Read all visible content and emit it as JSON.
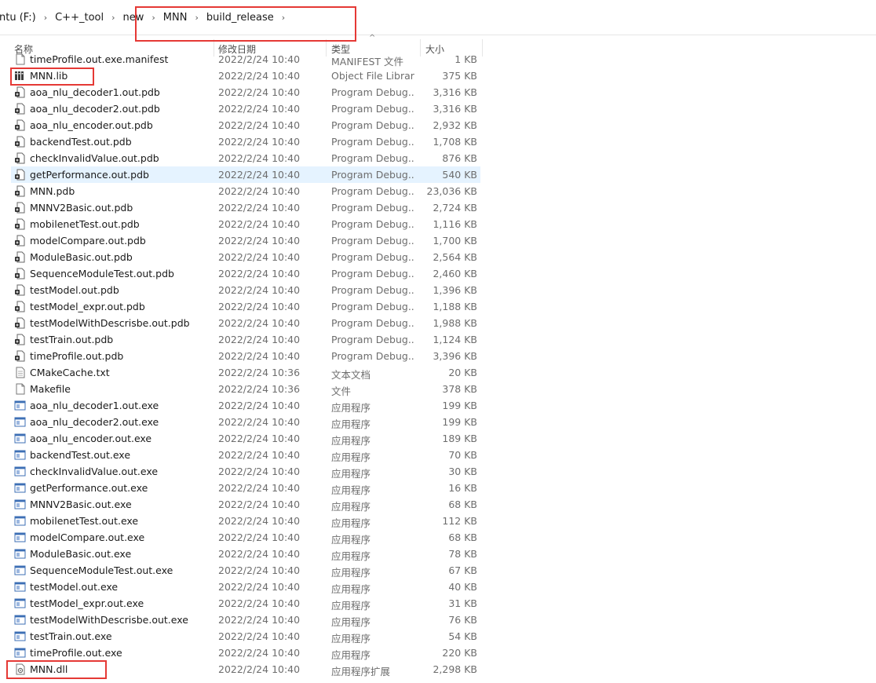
{
  "breadcrumb": {
    "items": [
      "ntu (F:)",
      "C++_tool",
      "new",
      "MNN",
      "build_release"
    ],
    "separator": "›"
  },
  "columns": {
    "name": "名称",
    "date": "修改日期",
    "type": "类型",
    "size": "大小",
    "sort_icon": "^"
  },
  "colors": {
    "highlight": "#e53935",
    "selected_row": "#e5f3ff"
  },
  "files": [
    {
      "name": "timeProfile.out.exe.manifest",
      "date": "2022/2/24 10:40",
      "type": "MANIFEST 文件",
      "size": "1 KB",
      "icon": "manifest-file-icon"
    },
    {
      "name": "MNN.lib",
      "date": "2022/2/24 10:40",
      "type": "Object File Library",
      "size": "375 KB",
      "icon": "library-file-icon"
    },
    {
      "name": "aoa_nlu_decoder1.out.pdb",
      "date": "2022/2/24 10:40",
      "type": "Program Debug...",
      "size": "3,316 KB",
      "icon": "pdb-file-icon"
    },
    {
      "name": "aoa_nlu_decoder2.out.pdb",
      "date": "2022/2/24 10:40",
      "type": "Program Debug...",
      "size": "3,316 KB",
      "icon": "pdb-file-icon"
    },
    {
      "name": "aoa_nlu_encoder.out.pdb",
      "date": "2022/2/24 10:40",
      "type": "Program Debug...",
      "size": "2,932 KB",
      "icon": "pdb-file-icon"
    },
    {
      "name": "backendTest.out.pdb",
      "date": "2022/2/24 10:40",
      "type": "Program Debug...",
      "size": "1,708 KB",
      "icon": "pdb-file-icon"
    },
    {
      "name": "checkInvalidValue.out.pdb",
      "date": "2022/2/24 10:40",
      "type": "Program Debug...",
      "size": "876 KB",
      "icon": "pdb-file-icon"
    },
    {
      "name": "getPerformance.out.pdb",
      "date": "2022/2/24 10:40",
      "type": "Program Debug...",
      "size": "540 KB",
      "icon": "pdb-file-icon"
    },
    {
      "name": "MNN.pdb",
      "date": "2022/2/24 10:40",
      "type": "Program Debug...",
      "size": "23,036 KB",
      "icon": "pdb-file-icon"
    },
    {
      "name": "MNNV2Basic.out.pdb",
      "date": "2022/2/24 10:40",
      "type": "Program Debug...",
      "size": "2,724 KB",
      "icon": "pdb-file-icon"
    },
    {
      "name": "mobilenetTest.out.pdb",
      "date": "2022/2/24 10:40",
      "type": "Program Debug...",
      "size": "1,116 KB",
      "icon": "pdb-file-icon"
    },
    {
      "name": "modelCompare.out.pdb",
      "date": "2022/2/24 10:40",
      "type": "Program Debug...",
      "size": "1,700 KB",
      "icon": "pdb-file-icon"
    },
    {
      "name": "ModuleBasic.out.pdb",
      "date": "2022/2/24 10:40",
      "type": "Program Debug...",
      "size": "2,564 KB",
      "icon": "pdb-file-icon"
    },
    {
      "name": "SequenceModuleTest.out.pdb",
      "date": "2022/2/24 10:40",
      "type": "Program Debug...",
      "size": "2,460 KB",
      "icon": "pdb-file-icon"
    },
    {
      "name": "testModel.out.pdb",
      "date": "2022/2/24 10:40",
      "type": "Program Debug...",
      "size": "1,396 KB",
      "icon": "pdb-file-icon"
    },
    {
      "name": "testModel_expr.out.pdb",
      "date": "2022/2/24 10:40",
      "type": "Program Debug...",
      "size": "1,188 KB",
      "icon": "pdb-file-icon"
    },
    {
      "name": "testModelWithDescrisbe.out.pdb",
      "date": "2022/2/24 10:40",
      "type": "Program Debug...",
      "size": "1,988 KB",
      "icon": "pdb-file-icon"
    },
    {
      "name": "testTrain.out.pdb",
      "date": "2022/2/24 10:40",
      "type": "Program Debug...",
      "size": "1,124 KB",
      "icon": "pdb-file-icon"
    },
    {
      "name": "timeProfile.out.pdb",
      "date": "2022/2/24 10:40",
      "type": "Program Debug...",
      "size": "3,396 KB",
      "icon": "pdb-file-icon"
    },
    {
      "name": "CMakeCache.txt",
      "date": "2022/2/24 10:36",
      "type": "文本文档",
      "size": "20 KB",
      "icon": "text-file-icon"
    },
    {
      "name": "Makefile",
      "date": "2022/2/24 10:36",
      "type": "文件",
      "size": "378 KB",
      "icon": "blank-file-icon"
    },
    {
      "name": "aoa_nlu_decoder1.out.exe",
      "date": "2022/2/24 10:40",
      "type": "应用程序",
      "size": "199 KB",
      "icon": "exe-file-icon"
    },
    {
      "name": "aoa_nlu_decoder2.out.exe",
      "date": "2022/2/24 10:40",
      "type": "应用程序",
      "size": "199 KB",
      "icon": "exe-file-icon"
    },
    {
      "name": "aoa_nlu_encoder.out.exe",
      "date": "2022/2/24 10:40",
      "type": "应用程序",
      "size": "189 KB",
      "icon": "exe-file-icon"
    },
    {
      "name": "backendTest.out.exe",
      "date": "2022/2/24 10:40",
      "type": "应用程序",
      "size": "70 KB",
      "icon": "exe-file-icon"
    },
    {
      "name": "checkInvalidValue.out.exe",
      "date": "2022/2/24 10:40",
      "type": "应用程序",
      "size": "30 KB",
      "icon": "exe-file-icon"
    },
    {
      "name": "getPerformance.out.exe",
      "date": "2022/2/24 10:40",
      "type": "应用程序",
      "size": "16 KB",
      "icon": "exe-file-icon"
    },
    {
      "name": "MNNV2Basic.out.exe",
      "date": "2022/2/24 10:40",
      "type": "应用程序",
      "size": "68 KB",
      "icon": "exe-file-icon"
    },
    {
      "name": "mobilenetTest.out.exe",
      "date": "2022/2/24 10:40",
      "type": "应用程序",
      "size": "112 KB",
      "icon": "exe-file-icon"
    },
    {
      "name": "modelCompare.out.exe",
      "date": "2022/2/24 10:40",
      "type": "应用程序",
      "size": "68 KB",
      "icon": "exe-file-icon"
    },
    {
      "name": "ModuleBasic.out.exe",
      "date": "2022/2/24 10:40",
      "type": "应用程序",
      "size": "78 KB",
      "icon": "exe-file-icon"
    },
    {
      "name": "SequenceModuleTest.out.exe",
      "date": "2022/2/24 10:40",
      "type": "应用程序",
      "size": "67 KB",
      "icon": "exe-file-icon"
    },
    {
      "name": "testModel.out.exe",
      "date": "2022/2/24 10:40",
      "type": "应用程序",
      "size": "40 KB",
      "icon": "exe-file-icon"
    },
    {
      "name": "testModel_expr.out.exe",
      "date": "2022/2/24 10:40",
      "type": "应用程序",
      "size": "31 KB",
      "icon": "exe-file-icon"
    },
    {
      "name": "testModelWithDescrisbe.out.exe",
      "date": "2022/2/24 10:40",
      "type": "应用程序",
      "size": "76 KB",
      "icon": "exe-file-icon"
    },
    {
      "name": "testTrain.out.exe",
      "date": "2022/2/24 10:40",
      "type": "应用程序",
      "size": "54 KB",
      "icon": "exe-file-icon"
    },
    {
      "name": "timeProfile.out.exe",
      "date": "2022/2/24 10:40",
      "type": "应用程序",
      "size": "220 KB",
      "icon": "exe-file-icon"
    },
    {
      "name": "MNN.dll",
      "date": "2022/2/24 10:40",
      "type": "应用程序扩展",
      "size": "2,298 KB",
      "icon": "dll-file-icon"
    }
  ]
}
